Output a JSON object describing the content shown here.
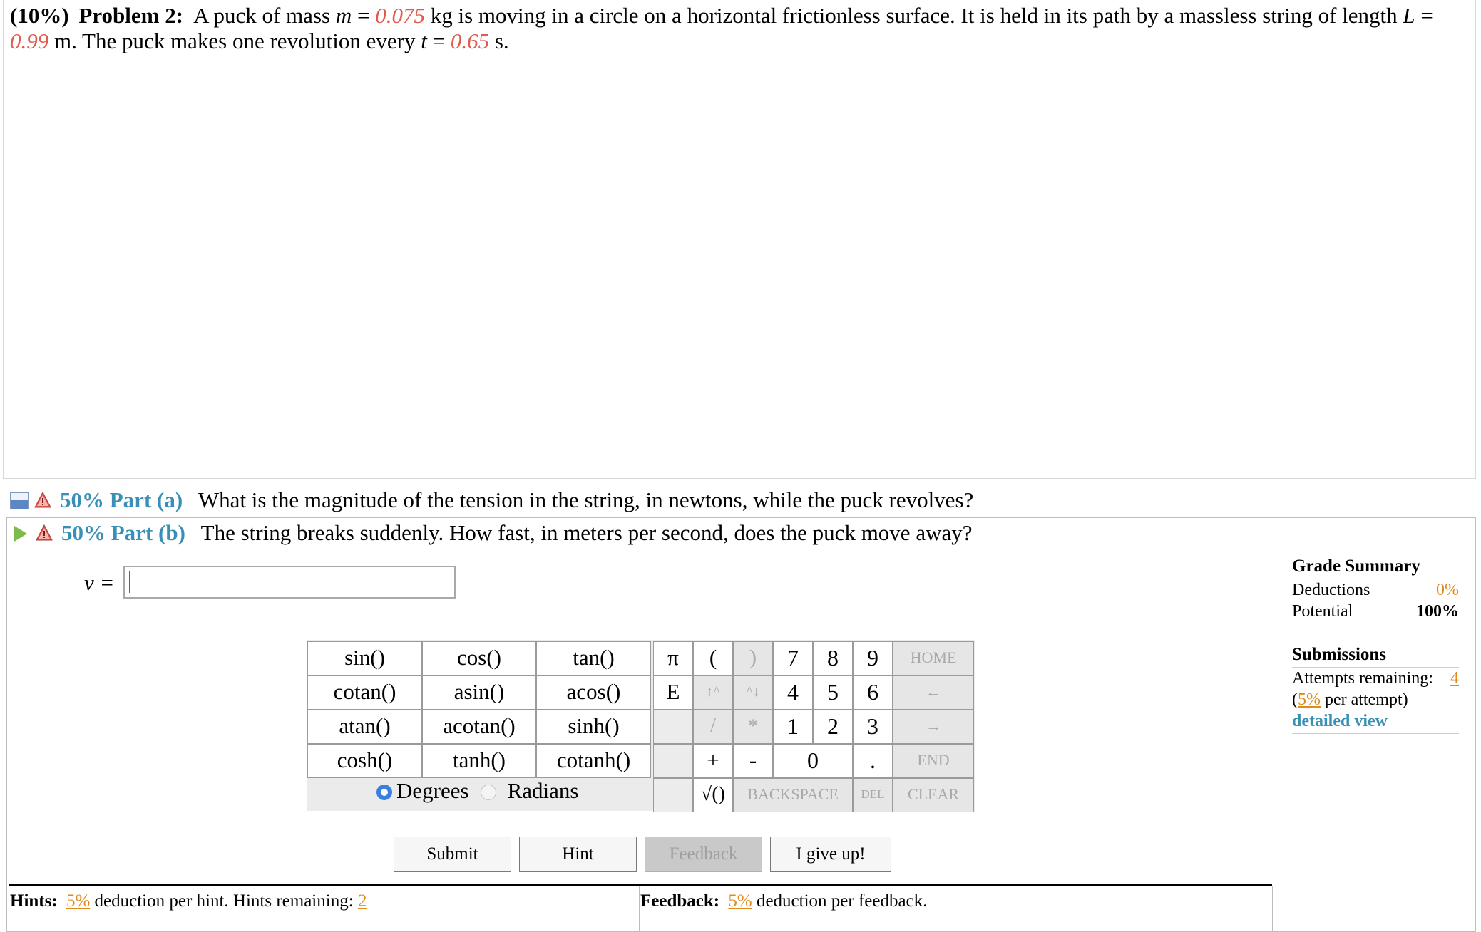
{
  "problem": {
    "weight": "(10%)",
    "label": "Problem 2:",
    "text_1": "A puck of mass ",
    "m_sym": "m",
    "eq1": " = ",
    "m_val": "0.075",
    "text_2": " kg is moving in a circle on a horizontal frictionless surface. It is held in its path by a massless string of length ",
    "L_sym": "L",
    "eq2": " = ",
    "L_val": "0.99",
    "text_3": " m. The puck makes one revolution every ",
    "t_sym": "t",
    "eq3": " = ",
    "t_val": "0.65",
    "text_4": " s."
  },
  "part_a": {
    "percent_label": "50% Part (a)",
    "question": "What is the magnitude of the tension in the string, in newtons, while the puck revolves?"
  },
  "part_b": {
    "percent_label": "50% Part (b)",
    "question": "The string breaks suddenly. How fast, in meters per second, does the puck move away?",
    "variable_label": "v =",
    "input_value": ""
  },
  "keypad": {
    "functions": [
      [
        "sin()",
        "cos()",
        "tan()"
      ],
      [
        "cotan()",
        "asin()",
        "acos()"
      ],
      [
        "atan()",
        "acotan()",
        "sinh()"
      ],
      [
        "cosh()",
        "tanh()",
        "cotanh()"
      ]
    ],
    "symbols": {
      "pi": "π",
      "lparen": "(",
      "rparen": ")",
      "e": "E",
      "up": "↑^",
      "down": "^↓",
      "slash": "/",
      "star": "*",
      "plus": "+",
      "minus": "-",
      "sqrt": "√()",
      "dot": "."
    },
    "digits": [
      "7",
      "8",
      "9",
      "4",
      "5",
      "6",
      "1",
      "2",
      "3",
      "0"
    ],
    "controls": {
      "home": "HOME",
      "left": "←",
      "right": "→",
      "end": "END",
      "backspace": "BACKSPACE",
      "del": "DEL",
      "clear": "CLEAR"
    },
    "mode_degrees": "Degrees",
    "mode_radians": "Radians",
    "selected_mode": "Degrees"
  },
  "buttons": {
    "submit": "Submit",
    "hint": "Hint",
    "feedback": "Feedback",
    "give_up": "I give up!"
  },
  "grade_summary": {
    "title": "Grade Summary",
    "deductions_label": "Deductions",
    "deductions_value": "0%",
    "potential_label": "Potential",
    "potential_value": "100%"
  },
  "submissions": {
    "title": "Submissions",
    "attempts_label": "Attempts remaining:",
    "attempts_value": "4",
    "per_attempt_open": "(",
    "per_attempt_value": "5%",
    "per_attempt_text": " per attempt)",
    "detailed_view": "detailed view"
  },
  "hints": {
    "label": "Hints:",
    "deduction_value": "5%",
    "deduction_text": " deduction per hint. Hints remaining: ",
    "remaining": "2"
  },
  "feedback": {
    "label": "Feedback:",
    "deduction_value": "5%",
    "deduction_text": " deduction per feedback."
  },
  "colors": {
    "given_values": "#e05a4e",
    "part_label": "#3a8fb7",
    "percent_accent": "#e08b1e"
  }
}
